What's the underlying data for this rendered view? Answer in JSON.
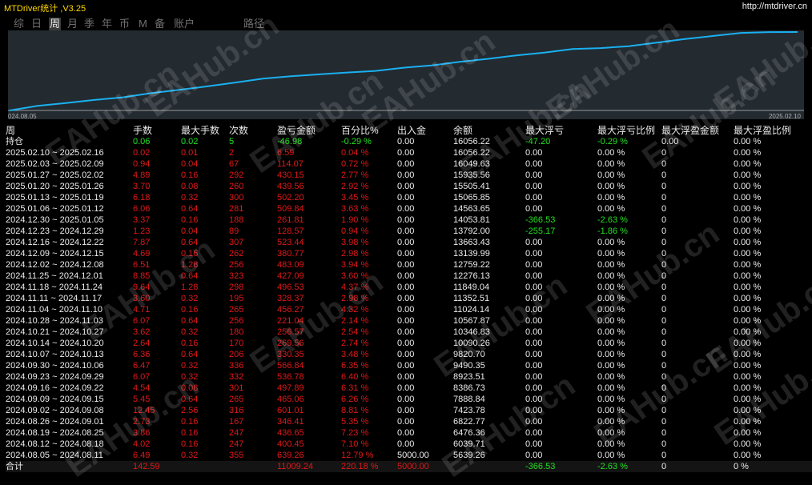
{
  "app": {
    "title": "MTDriver统计 ,V3.25",
    "site": "http://mtdriver.cn"
  },
  "menu": [
    {
      "label": "综",
      "name": "menu-summary"
    },
    {
      "label": "日",
      "name": "menu-day"
    },
    {
      "label": "周",
      "name": "menu-week",
      "active": true
    },
    {
      "label": "月",
      "name": "menu-month"
    },
    {
      "label": "季",
      "name": "menu-quarter"
    },
    {
      "label": "年",
      "name": "menu-year"
    },
    {
      "label": "币",
      "name": "menu-currency"
    },
    {
      "label": "M",
      "name": "menu-m"
    },
    {
      "label": "备",
      "name": "menu-backup"
    },
    {
      "label": "账户",
      "name": "menu-account"
    },
    {
      "label": "路径",
      "name": "menu-path"
    }
  ],
  "chart": {
    "x_start_label": "024.08.05",
    "x_end_label": "2025.02.10",
    "line_color": "#1ab0f0",
    "balance": [
      5000,
      5639.26,
      6039.71,
      6476.36,
      6822.77,
      7423.78,
      7888.84,
      8386.73,
      8923.51,
      9490.35,
      9820.7,
      10090.26,
      10346.83,
      10567.87,
      11024.14,
      11352.51,
      11849.04,
      12276.13,
      12759.22,
      13139.99,
      13663.43,
      13792.0,
      14053.81,
      14563.65,
      15065.85,
      15505.41,
      15935.56,
      16049.63,
      16056.22
    ]
  },
  "watermark": "EAHub.cn",
  "table": {
    "headers": [
      "周",
      "手数",
      "最大手数",
      "次数",
      "盈亏金额",
      "百分比%",
      "出入金",
      "余额",
      "最大浮亏",
      "最大浮亏比例",
      "最大浮盈金额",
      "最大浮盈比例"
    ],
    "position_row": {
      "label": "持仓",
      "lots": "0.06",
      "max_lots": "0.02",
      "count": "5",
      "pnl": "-46.98",
      "pct": "-0.29 %",
      "io": "0.00",
      "balance": "16056.22",
      "max_dd": "-47.20",
      "max_dd_pct": "-0.29 %",
      "max_profit": "0.00",
      "max_profit_pct": "0.00 %"
    },
    "rows": [
      {
        "period": "2025.02.10 ~ 2025.02.16",
        "lots": "0.02",
        "max_lots": "0.01",
        "count": "2",
        "pnl": "6.59",
        "pct": "0.04 %",
        "io": "0.00",
        "balance": "16056.22",
        "max_dd": "0.00",
        "max_dd_pct": "0.00 %",
        "max_profit": "0",
        "max_profit_pct": "0.00 %"
      },
      {
        "period": "2025.02.03 ~ 2025.02.09",
        "lots": "0.94",
        "max_lots": "0.04",
        "count": "67",
        "pnl": "114.07",
        "pct": "0.72 %",
        "io": "0.00",
        "balance": "16049.63",
        "max_dd": "0.00",
        "max_dd_pct": "0.00 %",
        "max_profit": "0",
        "max_profit_pct": "0.00 %"
      },
      {
        "period": "2025.01.27 ~ 2025.02.02",
        "lots": "4.89",
        "max_lots": "0.16",
        "count": "292",
        "pnl": "430.15",
        "pct": "2.77 %",
        "io": "0.00",
        "balance": "15935.56",
        "max_dd": "0.00",
        "max_dd_pct": "0.00 %",
        "max_profit": "0",
        "max_profit_pct": "0.00 %"
      },
      {
        "period": "2025.01.20 ~ 2025.01.26",
        "lots": "3.70",
        "max_lots": "0.08",
        "count": "260",
        "pnl": "439.56",
        "pct": "2.92 %",
        "io": "0.00",
        "balance": "15505.41",
        "max_dd": "0.00",
        "max_dd_pct": "0.00 %",
        "max_profit": "0",
        "max_profit_pct": "0.00 %"
      },
      {
        "period": "2025.01.13 ~ 2025.01.19",
        "lots": "6.18",
        "max_lots": "0.32",
        "count": "300",
        "pnl": "502.20",
        "pct": "3.45 %",
        "io": "0.00",
        "balance": "15065.85",
        "max_dd": "0.00",
        "max_dd_pct": "0.00 %",
        "max_profit": "0",
        "max_profit_pct": "0.00 %"
      },
      {
        "period": "2025.01.06 ~ 2025.01.12",
        "lots": "6.06",
        "max_lots": "0.64",
        "count": "281",
        "pnl": "509.84",
        "pct": "3.63 %",
        "io": "0.00",
        "balance": "14563.65",
        "max_dd": "0.00",
        "max_dd_pct": "0.00 %",
        "max_profit": "0",
        "max_profit_pct": "0.00 %"
      },
      {
        "period": "2024.12.30 ~ 2025.01.05",
        "lots": "3.37",
        "max_lots": "0.16",
        "count": "188",
        "pnl": "261.81",
        "pct": "1.90 %",
        "io": "0.00",
        "balance": "14053.81",
        "max_dd": "-366.53",
        "max_dd_pct": "-2.63 %",
        "max_profit": "0",
        "max_profit_pct": "0.00 %"
      },
      {
        "period": "2024.12.23 ~ 2024.12.29",
        "lots": "1.23",
        "max_lots": "0.04",
        "count": "89",
        "pnl": "128.57",
        "pct": "0.94 %",
        "io": "0.00",
        "balance": "13792.00",
        "max_dd": "-255.17",
        "max_dd_pct": "-1.86 %",
        "max_profit": "0",
        "max_profit_pct": "0.00 %"
      },
      {
        "period": "2024.12.16 ~ 2024.12.22",
        "lots": "7.87",
        "max_lots": "0.64",
        "count": "307",
        "pnl": "523.44",
        "pct": "3.98 %",
        "io": "0.00",
        "balance": "13663.43",
        "max_dd": "0.00",
        "max_dd_pct": "0.00 %",
        "max_profit": "0",
        "max_profit_pct": "0.00 %"
      },
      {
        "period": "2024.12.09 ~ 2024.12.15",
        "lots": "4.69",
        "max_lots": "0.16",
        "count": "262",
        "pnl": "380.77",
        "pct": "2.98 %",
        "io": "0.00",
        "balance": "13139.99",
        "max_dd": "0.00",
        "max_dd_pct": "0.00 %",
        "max_profit": "0",
        "max_profit_pct": "0.00 %"
      },
      {
        "period": "2024.12.02 ~ 2024.12.08",
        "lots": "6.51",
        "max_lots": "1.28",
        "count": "256",
        "pnl": "483.09",
        "pct": "3.94 %",
        "io": "0.00",
        "balance": "12759.22",
        "max_dd": "0.00",
        "max_dd_pct": "0.00 %",
        "max_profit": "0",
        "max_profit_pct": "0.00 %"
      },
      {
        "period": "2024.11.25 ~ 2024.12.01",
        "lots": "8.85",
        "max_lots": "0.64",
        "count": "323",
        "pnl": "427.09",
        "pct": "3.60 %",
        "io": "0.00",
        "balance": "12276.13",
        "max_dd": "0.00",
        "max_dd_pct": "0.00 %",
        "max_profit": "0",
        "max_profit_pct": "0.00 %"
      },
      {
        "period": "2024.11.18 ~ 2024.11.24",
        "lots": "9.64",
        "max_lots": "1.28",
        "count": "298",
        "pnl": "496.53",
        "pct": "4.37 %",
        "io": "0.00",
        "balance": "11849.04",
        "max_dd": "0.00",
        "max_dd_pct": "0.00 %",
        "max_profit": "0",
        "max_profit_pct": "0.00 %"
      },
      {
        "period": "2024.11.11 ~ 2024.11.17",
        "lots": "3.60",
        "max_lots": "0.32",
        "count": "195",
        "pnl": "328.37",
        "pct": "2.98 %",
        "io": "0.00",
        "balance": "11352.51",
        "max_dd": "0.00",
        "max_dd_pct": "0.00 %",
        "max_profit": "0",
        "max_profit_pct": "0.00 %"
      },
      {
        "period": "2024.11.04 ~ 2024.11.10",
        "lots": "4.71",
        "max_lots": "0.16",
        "count": "265",
        "pnl": "456.27",
        "pct": "4.32 %",
        "io": "0.00",
        "balance": "11024.14",
        "max_dd": "0.00",
        "max_dd_pct": "0.00 %",
        "max_profit": "0",
        "max_profit_pct": "0.00 %"
      },
      {
        "period": "2024.10.28 ~ 2024.11.03",
        "lots": "6.07",
        "max_lots": "0.64",
        "count": "256",
        "pnl": "221.04",
        "pct": "2.14 %",
        "io": "0.00",
        "balance": "10567.87",
        "max_dd": "0.00",
        "max_dd_pct": "0.00 %",
        "max_profit": "0",
        "max_profit_pct": "0.00 %"
      },
      {
        "period": "2024.10.21 ~ 2024.10.27",
        "lots": "3.62",
        "max_lots": "0.32",
        "count": "180",
        "pnl": "256.57",
        "pct": "2.54 %",
        "io": "0.00",
        "balance": "10346.83",
        "max_dd": "0.00",
        "max_dd_pct": "0.00 %",
        "max_profit": "0",
        "max_profit_pct": "0.00 %"
      },
      {
        "period": "2024.10.14 ~ 2024.10.20",
        "lots": "2.64",
        "max_lots": "0.16",
        "count": "170",
        "pnl": "269.56",
        "pct": "2.74 %",
        "io": "0.00",
        "balance": "10090.26",
        "max_dd": "0.00",
        "max_dd_pct": "0.00 %",
        "max_profit": "0",
        "max_profit_pct": "0.00 %"
      },
      {
        "period": "2024.10.07 ~ 2024.10.13",
        "lots": "6.36",
        "max_lots": "0.64",
        "count": "206",
        "pnl": "330.35",
        "pct": "3.48 %",
        "io": "0.00",
        "balance": "9820.70",
        "max_dd": "0.00",
        "max_dd_pct": "0.00 %",
        "max_profit": "0",
        "max_profit_pct": "0.00 %"
      },
      {
        "period": "2024.09.30 ~ 2024.10.06",
        "lots": "6.47",
        "max_lots": "0.32",
        "count": "336",
        "pnl": "566.84",
        "pct": "6.35 %",
        "io": "0.00",
        "balance": "9490.35",
        "max_dd": "0.00",
        "max_dd_pct": "0.00 %",
        "max_profit": "0",
        "max_profit_pct": "0.00 %"
      },
      {
        "period": "2024.09.23 ~ 2024.09.29",
        "lots": "6.07",
        "max_lots": "0.32",
        "count": "332",
        "pnl": "536.78",
        "pct": "6.40 %",
        "io": "0.00",
        "balance": "8923.51",
        "max_dd": "0.00",
        "max_dd_pct": "0.00 %",
        "max_profit": "0",
        "max_profit_pct": "0.00 %"
      },
      {
        "period": "2024.09.16 ~ 2024.09.22",
        "lots": "4.54",
        "max_lots": "0.08",
        "count": "301",
        "pnl": "497.89",
        "pct": "6.31 %",
        "io": "0.00",
        "balance": "8386.73",
        "max_dd": "0.00",
        "max_dd_pct": "0.00 %",
        "max_profit": "0",
        "max_profit_pct": "0.00 %"
      },
      {
        "period": "2024.09.09 ~ 2024.09.15",
        "lots": "5.45",
        "max_lots": "0.64",
        "count": "265",
        "pnl": "465.06",
        "pct": "6.26 %",
        "io": "0.00",
        "balance": "7888.84",
        "max_dd": "0.00",
        "max_dd_pct": "0.00 %",
        "max_profit": "0",
        "max_profit_pct": "0.00 %"
      },
      {
        "period": "2024.09.02 ~ 2024.09.08",
        "lots": "12.45",
        "max_lots": "2.56",
        "count": "316",
        "pnl": "601.01",
        "pct": "8.81 %",
        "io": "0.00",
        "balance": "7423.78",
        "max_dd": "0.00",
        "max_dd_pct": "0.00 %",
        "max_profit": "0",
        "max_profit_pct": "0.00 %"
      },
      {
        "period": "2024.08.26 ~ 2024.09.01",
        "lots": "2.73",
        "max_lots": "0.16",
        "count": "167",
        "pnl": "346.41",
        "pct": "5.35 %",
        "io": "0.00",
        "balance": "6822.77",
        "max_dd": "0.00",
        "max_dd_pct": "0.00 %",
        "max_profit": "0",
        "max_profit_pct": "0.00 %"
      },
      {
        "period": "2024.08.19 ~ 2024.08.25",
        "lots": "3.86",
        "max_lots": "0.16",
        "count": "247",
        "pnl": "436.65",
        "pct": "7.23 %",
        "io": "0.00",
        "balance": "6476.36",
        "max_dd": "0.00",
        "max_dd_pct": "0.00 %",
        "max_profit": "0",
        "max_profit_pct": "0.00 %"
      },
      {
        "period": "2024.08.12 ~ 2024.08.18",
        "lots": "4.02",
        "max_lots": "0.16",
        "count": "247",
        "pnl": "400.45",
        "pct": "7.10 %",
        "io": "0.00",
        "balance": "6039.71",
        "max_dd": "0.00",
        "max_dd_pct": "0.00 %",
        "max_profit": "0",
        "max_profit_pct": "0.00 %"
      },
      {
        "period": "2024.08.05 ~ 2024.08.11",
        "lots": "6.49",
        "max_lots": "0.32",
        "count": "355",
        "pnl": "639.26",
        "pct": "12.79 %",
        "io": "5000.00",
        "balance": "5639.26",
        "max_dd": "0.00",
        "max_dd_pct": "0.00 %",
        "max_profit": "0",
        "max_profit_pct": "0.00 %"
      }
    ],
    "totals": {
      "label": "合计",
      "lots": "142.59",
      "pnl": "11009.24",
      "pct": "220.18 %",
      "io": "5000.00",
      "max_dd": "-366.53",
      "max_dd_pct": "-2.63 %",
      "max_profit": "0",
      "max_profit_pct": "0 %"
    }
  }
}
